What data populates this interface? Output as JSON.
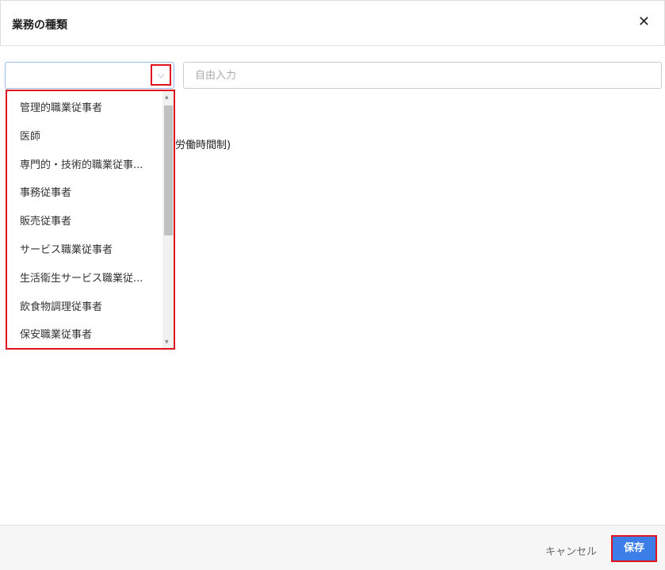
{
  "dialog": {
    "title": "業務の種類",
    "close": "✕"
  },
  "select": {
    "arrow": "⌵"
  },
  "free_input": {
    "placeholder": "自由入力",
    "value": ""
  },
  "background_text": "労働時間制)",
  "options": [
    "管理的職業従事者",
    "医師",
    "専門的・技術的職業従事...",
    "事務従事者",
    "販売従事者",
    "サービス職業従事者",
    "生活衛生サービス職業従...",
    "飲食物調理従事者",
    "保安職業従事者"
  ],
  "footer": {
    "cancel": "キャンセル",
    "save": "保存"
  }
}
